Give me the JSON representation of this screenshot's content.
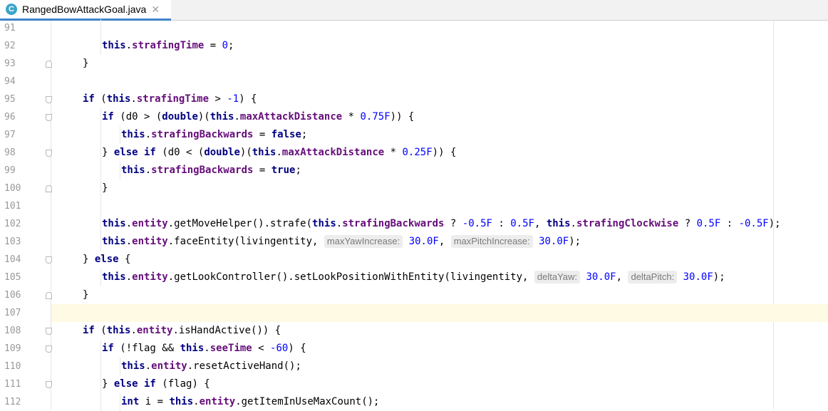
{
  "tab": {
    "icon_letter": "C",
    "filename": "RangedBowAttackGoal.java",
    "close_glyph": "✕"
  },
  "colors": {
    "keyword": "#000080",
    "field": "#660e7a",
    "number": "#0000ff",
    "caret_line": "#fffae3",
    "accent": "#4083c9"
  },
  "lines": [
    {
      "n": "91",
      "indent": 2,
      "tokens": []
    },
    {
      "n": "92",
      "indent": 2,
      "fold": null,
      "tokens": [
        {
          "t": "this",
          "c": "kw"
        },
        {
          "t": "."
        },
        {
          "t": "strafingTime",
          "c": "fld"
        },
        {
          "t": " = "
        },
        {
          "t": "0",
          "c": "num"
        },
        {
          "t": ";"
        }
      ]
    },
    {
      "n": "93",
      "indent": 1,
      "fold": "end",
      "tokens": [
        {
          "t": "}"
        }
      ]
    },
    {
      "n": "94",
      "indent": 1,
      "tokens": []
    },
    {
      "n": "95",
      "indent": 1,
      "fold": "start",
      "tokens": [
        {
          "t": "if",
          "c": "kw"
        },
        {
          "t": " ("
        },
        {
          "t": "this",
          "c": "kw"
        },
        {
          "t": "."
        },
        {
          "t": "strafingTime",
          "c": "fld"
        },
        {
          "t": " > "
        },
        {
          "t": "-1",
          "c": "num"
        },
        {
          "t": ") {"
        }
      ]
    },
    {
      "n": "96",
      "indent": 2,
      "fold": "start",
      "tokens": [
        {
          "t": "if",
          "c": "kw"
        },
        {
          "t": " (d0 > ("
        },
        {
          "t": "double",
          "c": "kw"
        },
        {
          "t": ")("
        },
        {
          "t": "this",
          "c": "kw"
        },
        {
          "t": "."
        },
        {
          "t": "maxAttackDistance",
          "c": "fld"
        },
        {
          "t": " * "
        },
        {
          "t": "0.75F",
          "c": "num"
        },
        {
          "t": ")) {"
        }
      ]
    },
    {
      "n": "97",
      "indent": 3,
      "tokens": [
        {
          "t": "this",
          "c": "kw"
        },
        {
          "t": "."
        },
        {
          "t": "strafingBackwards",
          "c": "fld"
        },
        {
          "t": " = "
        },
        {
          "t": "false",
          "c": "kw"
        },
        {
          "t": ";"
        }
      ]
    },
    {
      "n": "98",
      "indent": 2,
      "fold": "start",
      "tokens": [
        {
          "t": "} "
        },
        {
          "t": "else if",
          "c": "kw"
        },
        {
          "t": " (d0 < ("
        },
        {
          "t": "double",
          "c": "kw"
        },
        {
          "t": ")("
        },
        {
          "t": "this",
          "c": "kw"
        },
        {
          "t": "."
        },
        {
          "t": "maxAttackDistance",
          "c": "fld"
        },
        {
          "t": " * "
        },
        {
          "t": "0.25F",
          "c": "num"
        },
        {
          "t": ")) {"
        }
      ]
    },
    {
      "n": "99",
      "indent": 3,
      "tokens": [
        {
          "t": "this",
          "c": "kw"
        },
        {
          "t": "."
        },
        {
          "t": "strafingBackwards",
          "c": "fld"
        },
        {
          "t": " = "
        },
        {
          "t": "true",
          "c": "kw"
        },
        {
          "t": ";"
        }
      ]
    },
    {
      "n": "100",
      "indent": 2,
      "fold": "end",
      "tokens": [
        {
          "t": "}"
        }
      ]
    },
    {
      "n": "101",
      "indent": 2,
      "tokens": []
    },
    {
      "n": "102",
      "indent": 2,
      "tokens": [
        {
          "t": "this",
          "c": "kw"
        },
        {
          "t": "."
        },
        {
          "t": "entity",
          "c": "fld"
        },
        {
          "t": ".getMoveHelper().strafe("
        },
        {
          "t": "this",
          "c": "kw"
        },
        {
          "t": "."
        },
        {
          "t": "strafingBackwards",
          "c": "fld"
        },
        {
          "t": " ? "
        },
        {
          "t": "-0.5F",
          "c": "num"
        },
        {
          "t": " : "
        },
        {
          "t": "0.5F",
          "c": "num"
        },
        {
          "t": ", "
        },
        {
          "t": "this",
          "c": "kw"
        },
        {
          "t": "."
        },
        {
          "t": "strafingClockwise",
          "c": "fld"
        },
        {
          "t": " ? "
        },
        {
          "t": "0.5F",
          "c": "num"
        },
        {
          "t": " : "
        },
        {
          "t": "-0.5F",
          "c": "num"
        },
        {
          "t": ");"
        }
      ]
    },
    {
      "n": "103",
      "indent": 2,
      "tokens": [
        {
          "t": "this",
          "c": "kw"
        },
        {
          "t": "."
        },
        {
          "t": "entity",
          "c": "fld"
        },
        {
          "t": ".faceEntity(livingentity, "
        },
        {
          "t": "maxYawIncrease:",
          "c": "hint"
        },
        {
          "t": " "
        },
        {
          "t": "30.0F",
          "c": "num"
        },
        {
          "t": ", "
        },
        {
          "t": "maxPitchIncrease:",
          "c": "hint"
        },
        {
          "t": " "
        },
        {
          "t": "30.0F",
          "c": "num"
        },
        {
          "t": ");"
        }
      ]
    },
    {
      "n": "104",
      "indent": 1,
      "fold": "start",
      "tokens": [
        {
          "t": "} "
        },
        {
          "t": "else",
          "c": "kw"
        },
        {
          "t": " {"
        }
      ]
    },
    {
      "n": "105",
      "indent": 2,
      "tokens": [
        {
          "t": "this",
          "c": "kw"
        },
        {
          "t": "."
        },
        {
          "t": "entity",
          "c": "fld"
        },
        {
          "t": ".getLookController().setLookPositionWithEntity(livingentity, "
        },
        {
          "t": "deltaYaw:",
          "c": "hint"
        },
        {
          "t": " "
        },
        {
          "t": "30.0F",
          "c": "num"
        },
        {
          "t": ", "
        },
        {
          "t": "deltaPitch:",
          "c": "hint"
        },
        {
          "t": " "
        },
        {
          "t": "30.0F",
          "c": "num"
        },
        {
          "t": ");"
        }
      ]
    },
    {
      "n": "106",
      "indent": 1,
      "fold": "end",
      "tokens": [
        {
          "t": "}"
        }
      ]
    },
    {
      "n": "107",
      "indent": 1,
      "caret": true,
      "tokens": []
    },
    {
      "n": "108",
      "indent": 1,
      "fold": "start",
      "tokens": [
        {
          "t": "if",
          "c": "kw"
        },
        {
          "t": " ("
        },
        {
          "t": "this",
          "c": "kw"
        },
        {
          "t": "."
        },
        {
          "t": "entity",
          "c": "fld"
        },
        {
          "t": ".isHandActive()) {"
        }
      ]
    },
    {
      "n": "109",
      "indent": 2,
      "fold": "start",
      "tokens": [
        {
          "t": "if",
          "c": "kw"
        },
        {
          "t": " (!flag && "
        },
        {
          "t": "this",
          "c": "kw"
        },
        {
          "t": "."
        },
        {
          "t": "seeTime",
          "c": "fld"
        },
        {
          "t": " < "
        },
        {
          "t": "-60",
          "c": "num"
        },
        {
          "t": ") {"
        }
      ]
    },
    {
      "n": "110",
      "indent": 3,
      "tokens": [
        {
          "t": "this",
          "c": "kw"
        },
        {
          "t": "."
        },
        {
          "t": "entity",
          "c": "fld"
        },
        {
          "t": ".resetActiveHand();"
        }
      ]
    },
    {
      "n": "111",
      "indent": 2,
      "fold": "start",
      "tokens": [
        {
          "t": "} "
        },
        {
          "t": "else if",
          "c": "kw"
        },
        {
          "t": " (flag) {"
        }
      ]
    },
    {
      "n": "112",
      "indent": 3,
      "tokens": [
        {
          "t": "int",
          "c": "kw"
        },
        {
          "t": " i = "
        },
        {
          "t": "this",
          "c": "kw"
        },
        {
          "t": "."
        },
        {
          "t": "entity",
          "c": "fld"
        },
        {
          "t": ".getItemInUseMaxCount();"
        }
      ]
    }
  ]
}
